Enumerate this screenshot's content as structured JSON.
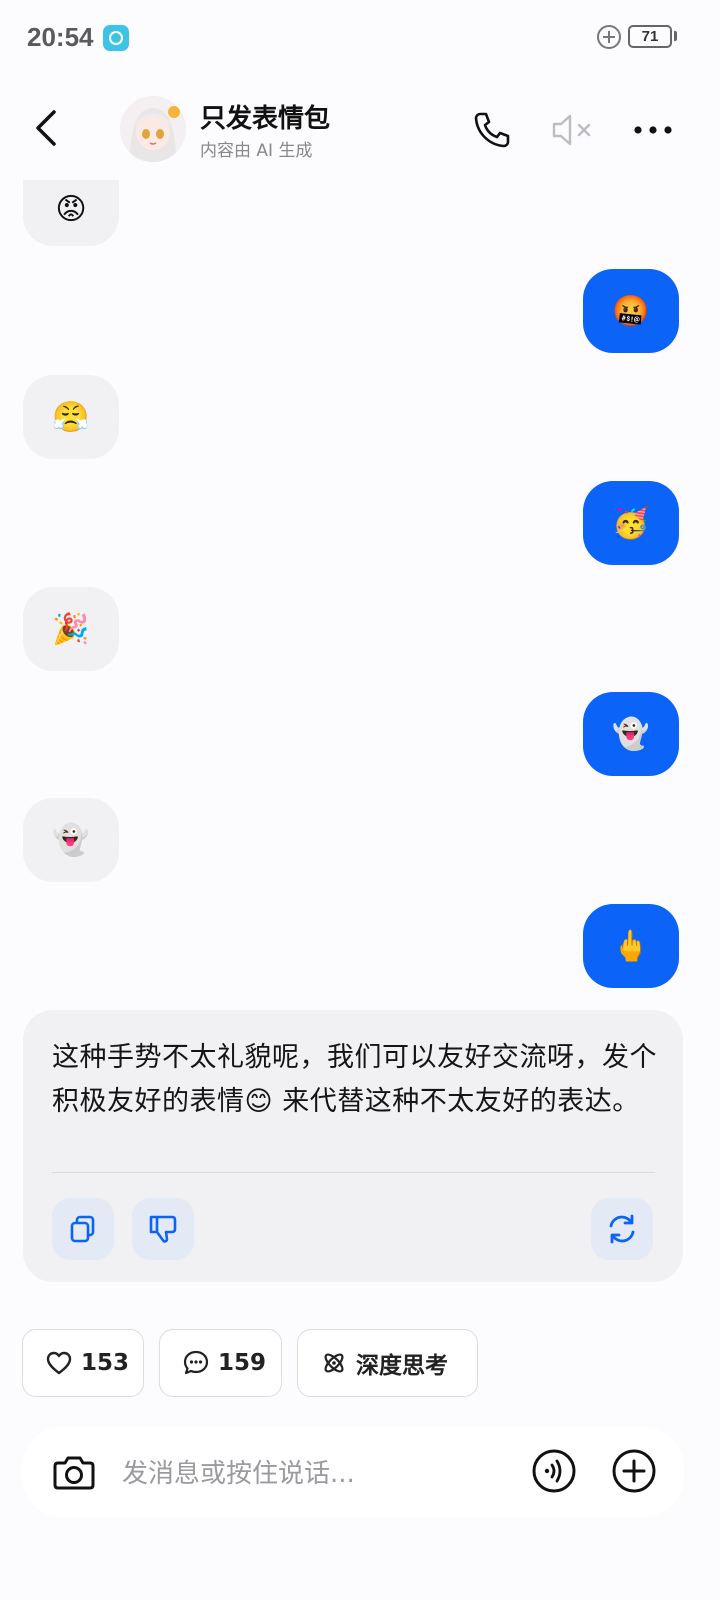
{
  "status_bar": {
    "time": "20:54",
    "battery": "71"
  },
  "header": {
    "title": "只发表情包",
    "subtitle": "内容由 AI 生成"
  },
  "messages": [
    {
      "side": "in",
      "emoji": "😡"
    },
    {
      "side": "out",
      "emoji": "🤬"
    },
    {
      "side": "in",
      "emoji": "😤"
    },
    {
      "side": "out",
      "emoji": "🥳"
    },
    {
      "side": "in",
      "emoji": "🎉"
    },
    {
      "side": "out",
      "emoji": "👻"
    },
    {
      "side": "in",
      "emoji": "👻"
    },
    {
      "side": "out",
      "emoji": "🖕"
    }
  ],
  "reply": {
    "text": "这种手势不太礼貌呢，我们可以友好交流呀，发个积极友好的表情😊 来代替这种不太友好的表达。",
    "actions": [
      "copy-icon",
      "thumbs-down-icon",
      "regenerate-icon"
    ]
  },
  "chips": {
    "likes": "153",
    "comments": "159",
    "deep_think": "深度思考"
  },
  "input": {
    "placeholder": "发消息或按住说话..."
  },
  "colors": {
    "accent": "#0c63f8",
    "bubble_in": "#f1f1f4"
  }
}
